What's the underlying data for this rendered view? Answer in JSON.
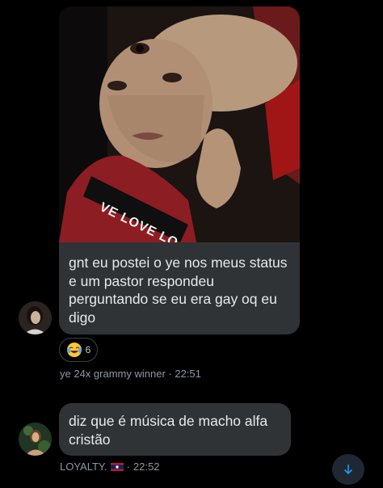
{
  "messages": [
    {
      "text": "gnt eu postei o ye nos meus status e um pastor respondeu perguntando se eu era gay oq eu digo",
      "image_caption_text": "VE LOVE LO",
      "reaction": {
        "emoji": "crying-laughing-emoji",
        "count": "6"
      },
      "sender": "ye 24x grammy winner",
      "separator": " · ",
      "time": "22:51"
    },
    {
      "text": "diz que é música de macho alfa cristão",
      "sender": "LOYALTY.",
      "separator": " · ",
      "time": "22:52"
    }
  ],
  "colors": {
    "background": "#000000",
    "bubble": "#2f3336",
    "meta_text": "#8b98a5",
    "scroll_button_bg": "#1e2732",
    "accent": "#1d9bf0"
  },
  "scroll_button": {
    "icon": "arrow-down-icon"
  }
}
